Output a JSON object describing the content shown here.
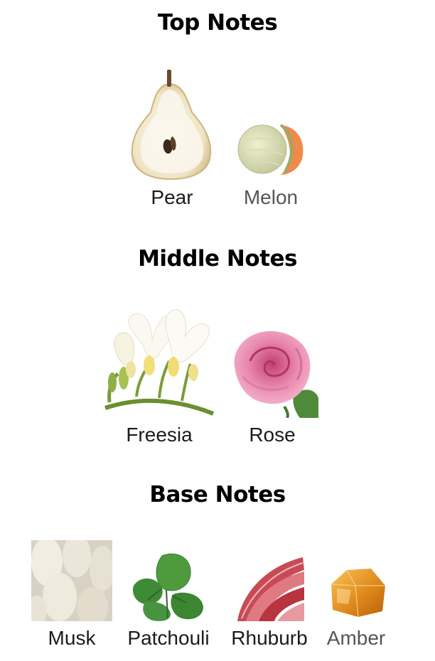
{
  "sections": [
    {
      "title": "Top Notes",
      "notes": [
        {
          "name": "Pear",
          "icon": "pear-icon"
        },
        {
          "name": "Melon",
          "icon": "melon-icon"
        }
      ]
    },
    {
      "title": "Middle Notes",
      "notes": [
        {
          "name": "Freesia",
          "icon": "freesia-icon"
        },
        {
          "name": "Rose",
          "icon": "rose-icon"
        }
      ]
    },
    {
      "title": "Base Notes",
      "notes": [
        {
          "name": "Musk",
          "icon": "musk-icon"
        },
        {
          "name": "Patchouli",
          "icon": "patchouli-icon"
        },
        {
          "name": "Rhuburb",
          "icon": "rhubarb-icon"
        },
        {
          "name": "Amber",
          "icon": "amber-icon"
        }
      ]
    }
  ]
}
